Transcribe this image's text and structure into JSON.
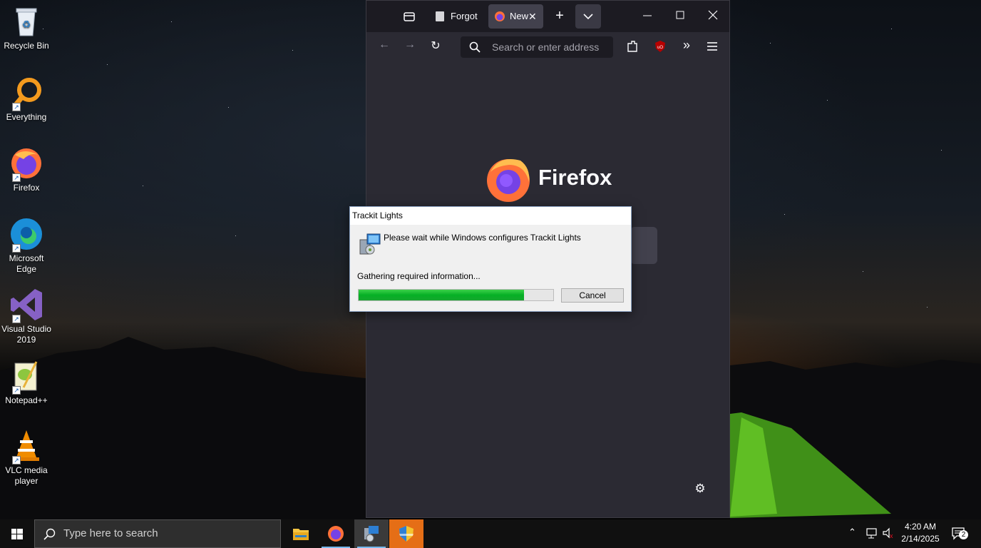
{
  "desktop": {
    "icons": [
      {
        "label": "Recycle Bin",
        "icon": "recycle-bin-icon"
      },
      {
        "label": "Everything",
        "icon": "everything-search-icon"
      },
      {
        "label": "Firefox",
        "icon": "firefox-icon"
      },
      {
        "label": "Microsoft Edge",
        "icon": "edge-icon"
      },
      {
        "label": "Visual Studio 2019",
        "icon": "visual-studio-icon"
      },
      {
        "label": "Notepad++",
        "icon": "notepad-plus-plus-icon"
      },
      {
        "label": "VLC media player",
        "icon": "vlc-icon"
      }
    ]
  },
  "firefox": {
    "tabs": [
      {
        "label": "Forgot",
        "icon": "page-icon",
        "active": false
      },
      {
        "label": "New",
        "icon": "firefox-icon",
        "active": true
      }
    ],
    "address_placeholder": "Search or enter address",
    "brand_text": "Firefox",
    "colors": {
      "frame": "#1c1b22",
      "toolbar": "#2b2a33",
      "accent_ublock": "#b70000"
    }
  },
  "dialog": {
    "title": "Trackit Lights",
    "message": "Please wait while Windows configures Trackit Lights",
    "status": "Gathering required information...",
    "progress": 0.85,
    "cancel_label": "Cancel",
    "progress_color": "#06b025"
  },
  "taskbar": {
    "search_placeholder": "Type here to search",
    "apps": [
      {
        "name": "file-explorer",
        "running": false
      },
      {
        "name": "firefox",
        "running": true
      },
      {
        "name": "installer",
        "running": true,
        "active": true
      },
      {
        "name": "user-account-control",
        "running": false,
        "highlight": true
      }
    ],
    "time": "4:20 AM",
    "date": "2/14/2025",
    "notification_count": "2"
  }
}
